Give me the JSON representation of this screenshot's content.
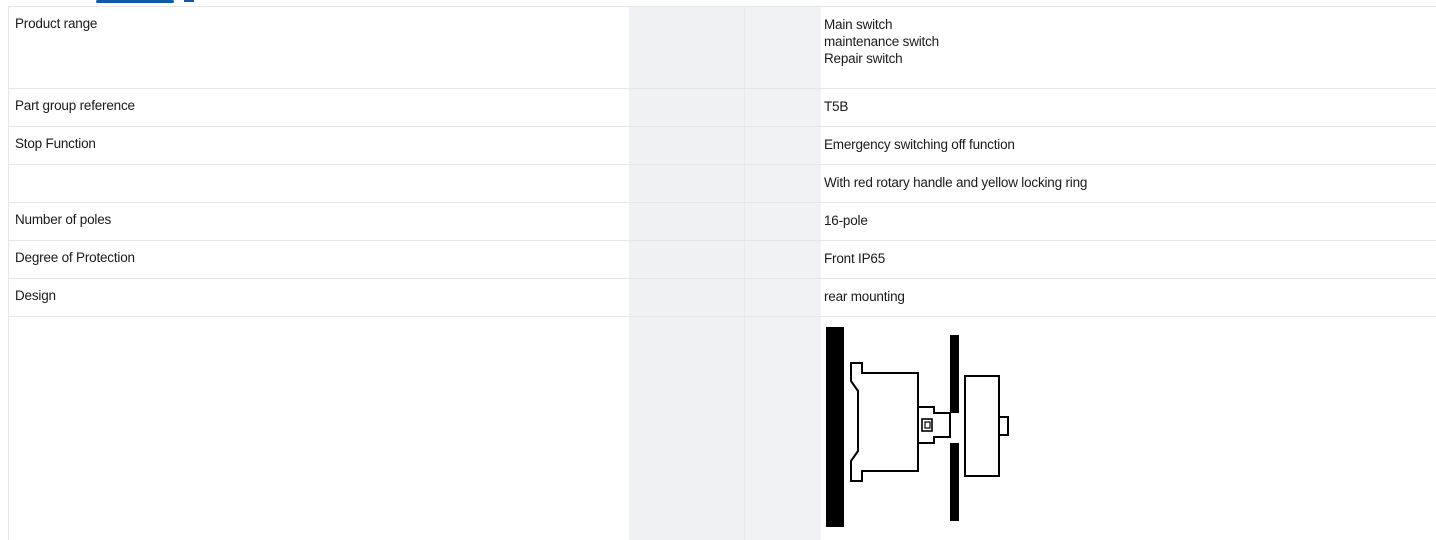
{
  "rows": [
    {
      "label": "Product range",
      "values": [
        "Main switch",
        "maintenance switch",
        "Repair switch"
      ]
    },
    {
      "label": "Part group reference",
      "values": [
        "T5B"
      ]
    },
    {
      "label": "Stop Function",
      "values": [
        "Emergency switching off function"
      ]
    },
    {
      "label": "",
      "values": [
        "With red rotary handle and yellow locking ring"
      ]
    },
    {
      "label": "Number of poles",
      "values": [
        "16-pole"
      ]
    },
    {
      "label": "Degree of Protection",
      "values": [
        "Front IP65"
      ]
    },
    {
      "label": "Design",
      "values": [
        "rear mounting"
      ]
    },
    {
      "label": "",
      "values": []
    }
  ],
  "diagram": {
    "icon": "rear-mounting-diagram-icon"
  },
  "colors": {
    "accent": "#0f5aa8",
    "shade": "#eff1f4",
    "border": "#e6e6e6"
  }
}
